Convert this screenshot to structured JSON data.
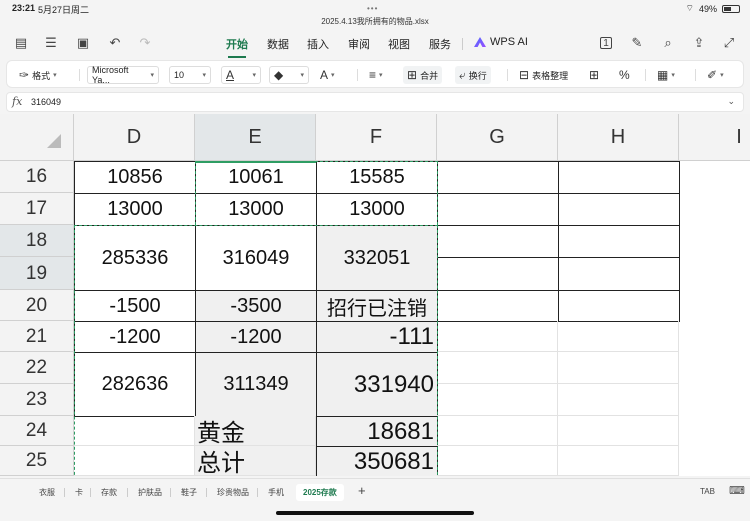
{
  "status": {
    "time": "23:21",
    "date": "5月27日周二",
    "battery": "49%",
    "battery_level": 0.49
  },
  "file": {
    "name": "2025.4.13我所拥有的物品.xlsx"
  },
  "menu": {
    "tabs": [
      "开始",
      "数据",
      "插入",
      "审阅",
      "视图",
      "服务"
    ],
    "active_tab": "开始",
    "ai_label": "WPS AI"
  },
  "toolbar": {
    "format_label": "格式",
    "font_name": "Microsoft Ya...",
    "font_size": "10",
    "font_color_glyph": "A",
    "fill_glyph": "◆",
    "font_style_glyph": "A",
    "merge_label": "合并",
    "wrap_label": "换行",
    "table_label": "表格整理",
    "percent_glyph": "%"
  },
  "formula_bar": {
    "fx": "fx",
    "value": "316049"
  },
  "columns": [
    "D",
    "E",
    "F",
    "G",
    "H",
    "I"
  ],
  "rows": [
    "16",
    "17",
    "18",
    "19",
    "20",
    "21",
    "22",
    "23",
    "24",
    "25"
  ],
  "cells": {
    "d16": "10856",
    "e16": "10061",
    "f16": "15585",
    "d17": "13000",
    "e17": "13000",
    "f17": "13000",
    "d18": "285336",
    "e18": "316049",
    "f18": "332051",
    "d20": "-1500",
    "e20": "-3500",
    "f20": "招行已注销",
    "d21": "-1200",
    "e21": "-1200",
    "f21": "-111",
    "d22": "282636",
    "e22": "311349",
    "f22": "331940",
    "e24": "黄金",
    "f24": "18681",
    "e25": "总计",
    "f25": "350681"
  },
  "sheets": [
    "衣服",
    "卡",
    "存款",
    "护肤品",
    "鞋子",
    "珍贵物品",
    "手机",
    "2025存款"
  ],
  "active_sheet": "2025存款",
  "sheet_add": "+",
  "tab_key": "TAB",
  "colors": {
    "accent": "#1e7a4f",
    "selection": "#2e9d63"
  }
}
